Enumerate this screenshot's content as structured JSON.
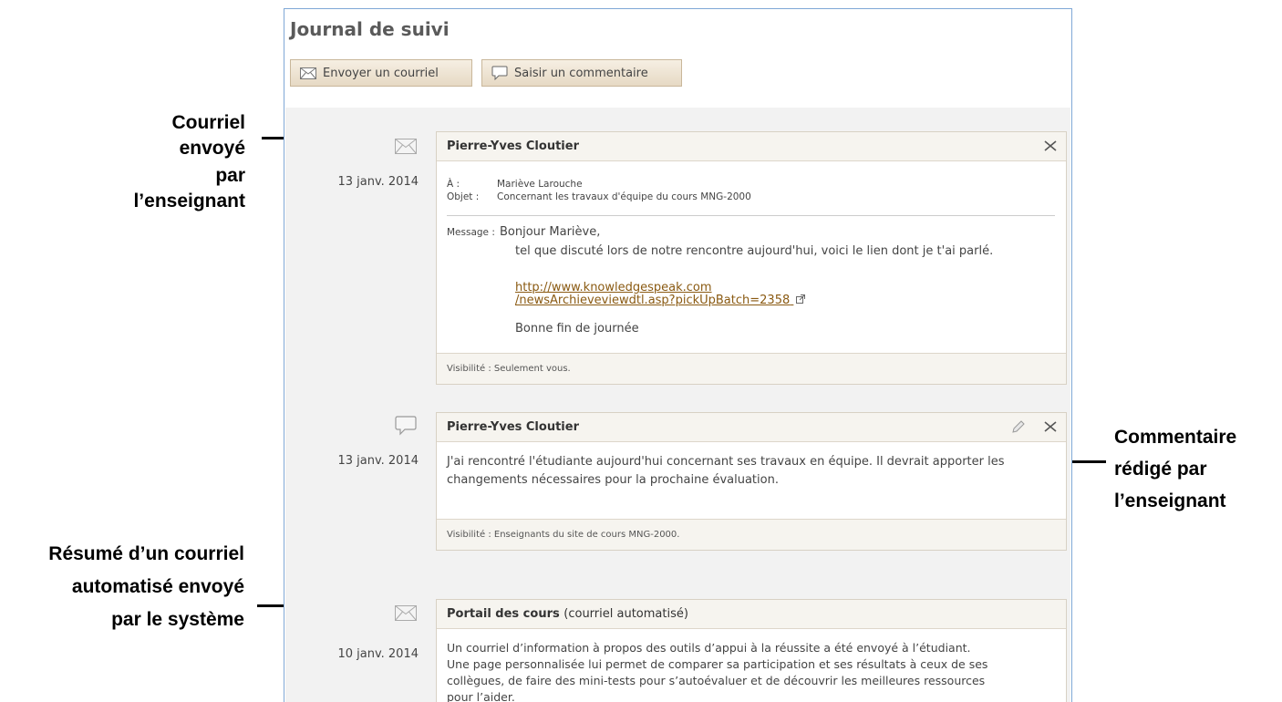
{
  "callouts": {
    "email_sent": [
      "Courriel envoyé",
      "par l’enseignant"
    ],
    "comment": [
      "Commentaire",
      "rédigé par",
      "l’enseignant"
    ],
    "auto_email": [
      "Résumé d’un courriel",
      "automatisé envoyé",
      "par le système"
    ]
  },
  "panel": {
    "title": "Journal de suivi",
    "buttons": {
      "send_email": "Envoyer un courriel",
      "add_comment": "Saisir un commentaire"
    }
  },
  "entries": [
    {
      "type_icon": "envelope-icon",
      "date": "13 janv. 2014",
      "author": "Pierre-Yves Cloutier",
      "to_label": "À :",
      "to_value": "Mariève Larouche",
      "subject_label": "Objet :",
      "subject_value": "Concernant les travaux d'équipe du cours MNG-2000",
      "message_label": "Message :",
      "greeting": "Bonjour Mariève,",
      "body": "tel que discuté lors de notre rencontre aujourd'hui, voici le lien dont je t'ai parlé.",
      "link_line1": "http://www.knowledgespeak.com",
      "link_line2": "/newsArchieveviewdtl.asp?pickUpBatch=2358",
      "closing": "Bonne fin de journée",
      "visibility": "Visibilité : Seulement vous."
    },
    {
      "type_icon": "speech-bubble-icon",
      "date": "13 janv. 2014",
      "author": "Pierre-Yves Cloutier",
      "body": "J'ai rencontré l'étudiante aujourd'hui concernant ses travaux en équipe. Il devrait apporter les changements nécessaires pour la prochaine évaluation.",
      "visibility": "Visibilité : Enseignants du site de cours MNG-2000."
    },
    {
      "type_icon": "envelope-icon",
      "date": "10 janv. 2014",
      "author": "Portail des cours",
      "author_suffix": "(courriel automatisé)",
      "body": "Un courriel d’information à propos des outils d’appui à la réussite a été envoyé à l’étudiant. Une page personnalisée lui permet de comparer sa participation et ses résultats à ceux de ses collègues, de faire des mini-tests pour s’autoévaluer et de découvrir les meilleures ressources pour l’aider."
    }
  ]
}
